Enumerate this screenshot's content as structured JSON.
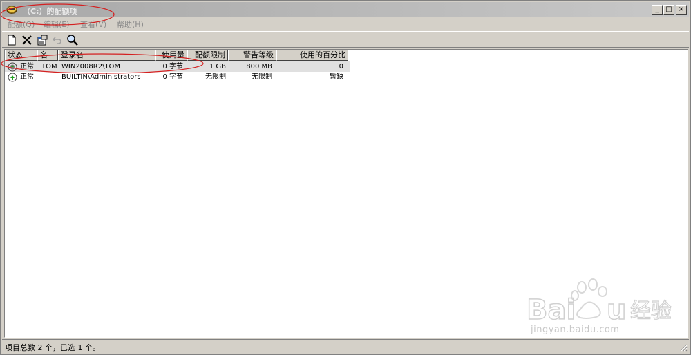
{
  "window": {
    "title": "（C:）的配额项",
    "controls": {
      "minimize": "_",
      "maximize": "□",
      "close": "×"
    }
  },
  "menu": [
    {
      "label": "配额(Q)"
    },
    {
      "label": "编辑(E)"
    },
    {
      "label": "查看(V)"
    },
    {
      "label": "帮助(H)"
    }
  ],
  "toolbar": {
    "buttons": [
      {
        "icon": "new-quota-entry-icon"
      },
      {
        "icon": "delete-icon"
      },
      {
        "icon": "properties-icon"
      },
      {
        "icon": "undo-icon"
      },
      {
        "icon": "find-icon"
      }
    ]
  },
  "table": {
    "columns": [
      "状态",
      "名",
      "登录名",
      "使用量",
      "配额限制",
      "警告等级",
      "使用的百分比"
    ],
    "rows": [
      {
        "status": "正常",
        "name": "TOM",
        "login": "WIN2008R2\\TOM",
        "usage": "0 字节",
        "limit": "1 GB",
        "warning": "800 MB",
        "percent": "0",
        "selected": true
      },
      {
        "status": "正常",
        "name": "",
        "login": "BUILTIN\\Administrators",
        "usage": "0 字节",
        "limit": "无限制",
        "warning": "无限制",
        "percent": "暂缺",
        "selected": false
      }
    ]
  },
  "statusbar": {
    "text": "项目总数 2 个，已选 1 个。"
  },
  "watermark": {
    "brand": "Baidu经验",
    "url": "jingyan.baidu.com"
  },
  "colors": {
    "annotation": "#d42020",
    "title_gradient_start": "#a8a8a8",
    "title_gradient_end": "#c8c8c8"
  }
}
